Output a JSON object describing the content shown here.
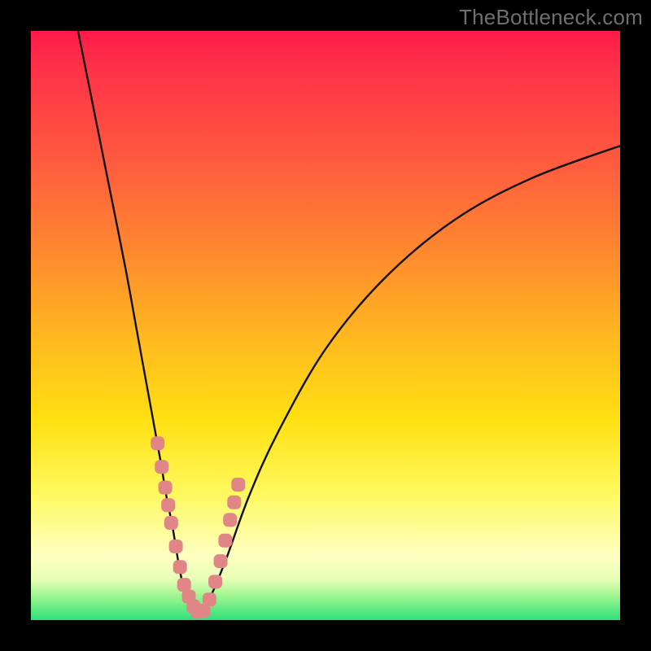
{
  "watermark": "TheBottleneck.com",
  "colors": {
    "frame": "#000000",
    "gradient_top": "#ff1a49",
    "gradient_mid": "#ffe012",
    "gradient_bottom": "#2ee07a",
    "curve": "#111111",
    "marker": "#e08686"
  },
  "chart_data": {
    "type": "line",
    "title": "",
    "xlabel": "",
    "ylabel": "",
    "xlim": [
      0,
      100
    ],
    "ylim": [
      0,
      100
    ],
    "series": [
      {
        "name": "bottleneck-curve",
        "x": [
          8,
          10,
          12,
          14,
          16,
          18,
          20,
          22,
          23,
          24,
          25,
          26,
          27,
          28,
          30,
          33,
          37,
          42,
          50,
          60,
          72,
          85,
          100
        ],
        "y": [
          100,
          90,
          80,
          70,
          60,
          49,
          38,
          27,
          21,
          16,
          10,
          5,
          2,
          0.6,
          3,
          10,
          21,
          32,
          46,
          58,
          68,
          75,
          80.5
        ]
      }
    ],
    "markers": {
      "name": "highlight-dots",
      "x": [
        21.5,
        22.2,
        22.8,
        23.3,
        23.8,
        24.6,
        25.3,
        26.0,
        26.8,
        27.6,
        28.3,
        29.3,
        30.3,
        31.3,
        32.2,
        33.0,
        33.8,
        34.5,
        35.2
      ],
      "y": [
        30,
        26,
        22.5,
        19.5,
        16.5,
        12.5,
        9,
        6,
        4,
        2.3,
        1.4,
        1.6,
        3.5,
        6.5,
        10,
        13.5,
        17,
        20,
        23
      ]
    }
  }
}
